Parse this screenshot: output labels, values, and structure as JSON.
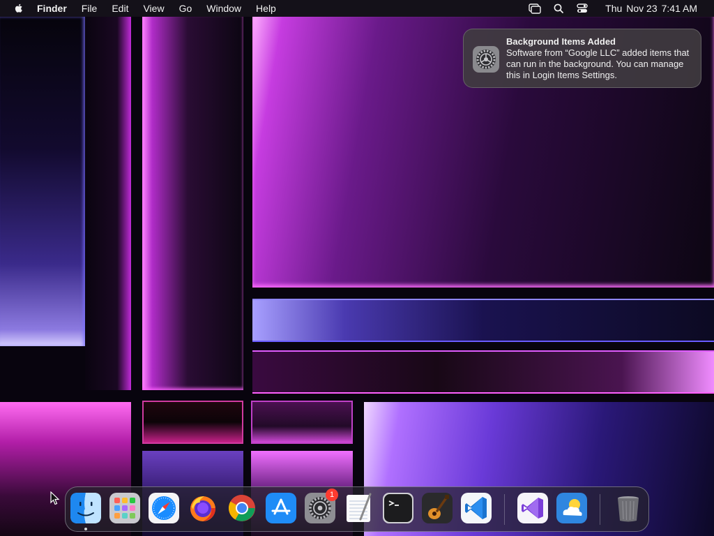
{
  "menubar": {
    "app_name": "Finder",
    "menus": [
      "File",
      "Edit",
      "View",
      "Go",
      "Window",
      "Help"
    ],
    "status_icons": [
      "screen-mirroring-icon",
      "spotlight-search-icon",
      "control-center-icon"
    ],
    "clock": {
      "day": "Thu",
      "date": "Nov 23",
      "time": "7:41 AM"
    }
  },
  "notification": {
    "title": "Background Items Added",
    "body": "Software from “Google LLC” added items that can run in the background. You can manage this in Login Items Settings.",
    "icon": "system-settings-icon"
  },
  "dock": {
    "items": [
      {
        "name": "Finder",
        "icon": "finder-icon",
        "running": true
      },
      {
        "name": "Launchpad",
        "icon": "launchpad-icon"
      },
      {
        "name": "Safari",
        "icon": "safari-icon"
      },
      {
        "name": "Firefox",
        "icon": "firefox-icon"
      },
      {
        "name": "Google Chrome",
        "icon": "chrome-icon"
      },
      {
        "name": "App Store",
        "icon": "app-store-icon"
      },
      {
        "name": "System Settings",
        "icon": "system-settings-icon",
        "badge": "1"
      },
      {
        "name": "TextEdit",
        "icon": "textedit-icon"
      },
      {
        "name": "Terminal",
        "icon": "terminal-icon"
      },
      {
        "name": "GarageBand",
        "icon": "garageband-icon"
      },
      {
        "name": "Visual Studio Code",
        "icon": "vscode-icon"
      },
      {
        "name": "Visual Studio",
        "icon": "visual-studio-icon"
      },
      {
        "name": "Weather",
        "icon": "weather-icon"
      },
      {
        "name": "Trash",
        "icon": "trash-icon"
      }
    ]
  },
  "colors": {
    "accent_magenta": "#e05cff",
    "accent_violet": "#7a5cff",
    "badge_red": "#ff3b30"
  }
}
